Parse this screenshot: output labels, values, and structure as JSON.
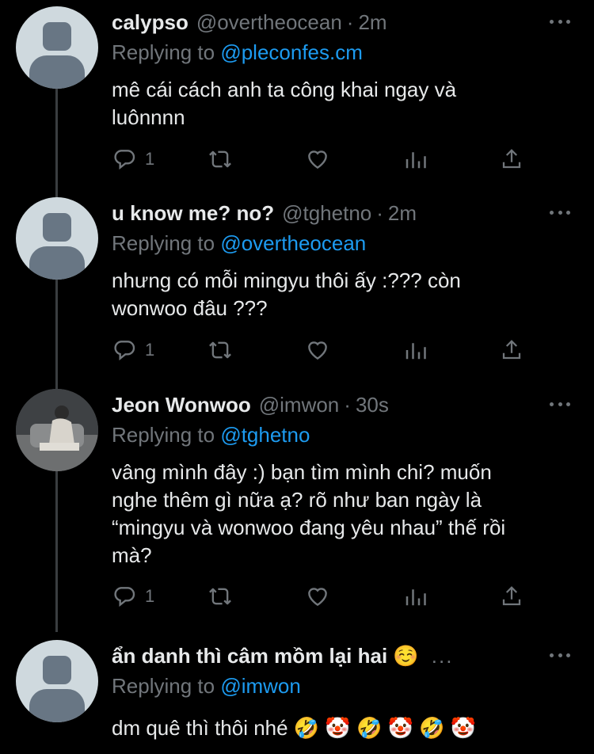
{
  "tweets": [
    {
      "name": "calypso",
      "handle": "@overtheocean",
      "sep": "·",
      "time": "2m",
      "replying_prefix": "Replying to ",
      "replying_to": "@pleconfes.cm",
      "text": "mê cái cách anh ta công khai ngay và\nluônnnn",
      "reply_count": "1",
      "avatar": "default-avatar"
    },
    {
      "name": "u know me? no?",
      "handle": "@tghetno",
      "sep": "·",
      "time": "2m",
      "replying_prefix": "Replying to ",
      "replying_to": "@overtheocean",
      "text": "nhưng có mỗi mingyu thôi ấy :??? còn\nwonwoo đâu ???",
      "reply_count": "1",
      "avatar": "default-avatar"
    },
    {
      "name": "Jeon Wonwoo",
      "handle": "@imwon",
      "sep": "·",
      "time": "30s",
      "replying_prefix": "Replying to ",
      "replying_to": "@tghetno",
      "text": "vâng mình đây :) bạn tìm mình chi? muốn\nnghe thêm gì nữa ạ? rõ như ban ngày là\n“mingyu và wonwoo đang yêu nhau” thế rồi\nmà?",
      "reply_count": "1",
      "avatar": "photo-avatar"
    },
    {
      "name": "ẩn danh thì câm mồm lại hai ☺️",
      "ellipsis": "...",
      "replying_prefix": "Replying to ",
      "replying_to": "@imwon",
      "text": "dm quê thì thôi nhé 🤣 🤡 🤣 🤡 🤣 🤡",
      "avatar": "default-avatar"
    }
  ],
  "icons": {
    "reply": "reply-icon",
    "retweet": "retweet-icon",
    "like": "heart-icon",
    "views": "analytics-icon",
    "share": "share-icon",
    "more": "more-icon"
  },
  "colors": {
    "background": "#000000",
    "text": "#e7e9ea",
    "secondary": "#71767b",
    "accent": "#1d9bf0"
  }
}
